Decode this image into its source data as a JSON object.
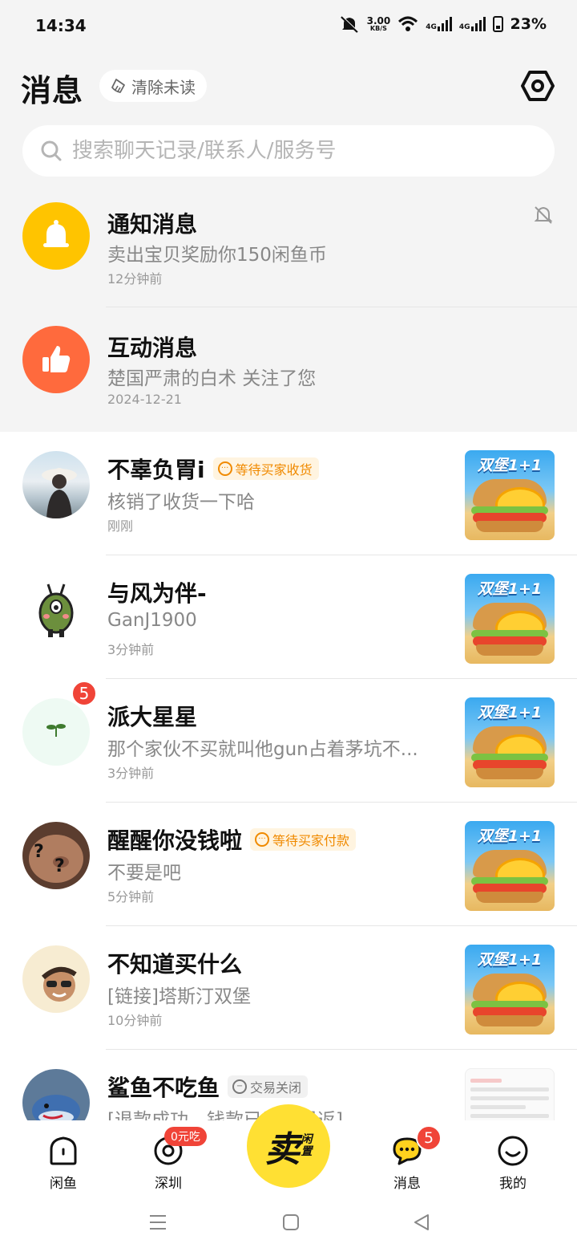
{
  "status_bar": {
    "time": "14:34",
    "speed_value": "3.00",
    "speed_unit": "KB/S",
    "net1": "4G",
    "net2": "4G",
    "battery": "23%"
  },
  "header": {
    "title": "消息",
    "clear_unread": "清除未读",
    "settings_icon": "settings-hexagon-icon"
  },
  "search": {
    "placeholder": "搜索聊天记录/联系人/服务号"
  },
  "system_messages": [
    {
      "name": "通知消息",
      "message": "卖出宝贝奖励你150闲鱼币",
      "time": "12分钟前",
      "icon": "bell-icon",
      "color": "#ffc400",
      "muted": true
    },
    {
      "name": "互动消息",
      "message": "楚国严肃的白术 关注了您",
      "time": "2024-12-21",
      "icon": "thumbs-up-icon",
      "color": "#ff6a3d"
    }
  ],
  "chats": [
    {
      "name": "不辜负胃i",
      "tag": "等待买家收货",
      "tag_style": "orange",
      "message": "核销了收货一下哈",
      "time": "刚刚",
      "thumb": "双堡1+1"
    },
    {
      "name": "与风为伴-",
      "tag": "",
      "message": "GanJ1900",
      "time": "3分钟前",
      "thumb": "双堡1+1"
    },
    {
      "name": "派大星星",
      "tag": "",
      "badge": "5",
      "message": "那个家伙不买就叫他gun占着茅坑不...",
      "time": "3分钟前",
      "thumb": "双堡1+1"
    },
    {
      "name": "醒醒你没钱啦",
      "tag": "等待买家付款",
      "tag_style": "orange",
      "message": "不要是吧",
      "time": "5分钟前",
      "thumb": "双堡1+1"
    },
    {
      "name": "不知道买什么",
      "tag": "",
      "message": "[链接]塔斯汀双堡",
      "time": "10分钟前",
      "thumb": "双堡1+1"
    },
    {
      "name": "鲨鱼不吃鱼",
      "tag": "交易关闭",
      "tag_style": "gray",
      "message": "[退款成功，钱款已原路退返]",
      "time": "",
      "thumb": ""
    }
  ],
  "bottom_nav": {
    "home": "闲鱼",
    "city": "深圳",
    "city_badge": "0元吃",
    "sell_big": "卖",
    "sell_small_1": "闲",
    "sell_small_2": "置",
    "messages": "消息",
    "messages_badge": "5",
    "me": "我的"
  },
  "colors": {
    "accent_yellow": "#ffe033",
    "badge_red": "#f04438",
    "tag_orange": "#f08a00"
  }
}
